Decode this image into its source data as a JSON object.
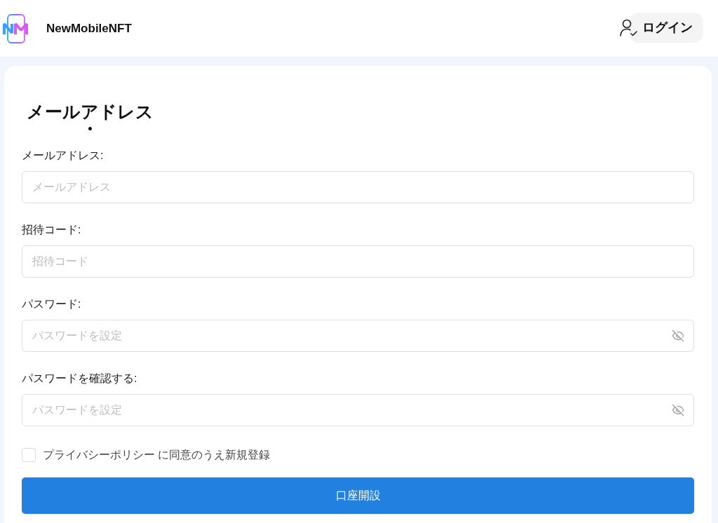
{
  "header": {
    "brand": "NewMobileNFT",
    "login_button": "ログイン"
  },
  "form": {
    "title": "メールアドレス",
    "fields": [
      {
        "kind": "text",
        "label": "メールアドレス:",
        "placeholder": "メールアドレス"
      },
      {
        "kind": "text",
        "label": "招待コード:",
        "placeholder": "招待コード"
      },
      {
        "kind": "password",
        "label": "パスワード:",
        "placeholder": "パスワードを設定"
      },
      {
        "kind": "password",
        "label": "パスワードを確認する:",
        "placeholder": "パスワードを設定"
      }
    ],
    "agreement": {
      "checked": false,
      "text": "プライバシーポリシー に同意のうえ新規登録"
    },
    "submit_button": "口座開設"
  }
}
